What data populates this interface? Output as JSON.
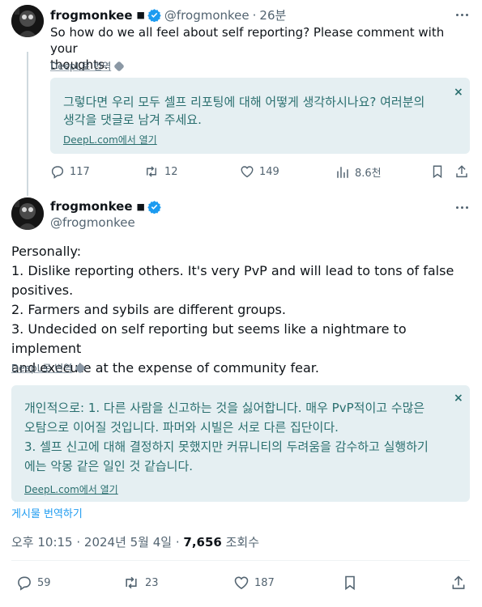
{
  "parent_tweet": {
    "display_name": "frogmonkee",
    "square": "■",
    "handle": "@frogmonkee",
    "separator": "·",
    "time": "26분",
    "text_line1": "So how do we all feel about self reporting? Please comment with your",
    "text_line2": "thoughts.",
    "deepl_label": "DeepL로 번역",
    "translation_line1": "그렇다면 우리 모두 셀프 리포팅에 대해 어떻게 생각하시나요? 여러분의",
    "translation_line2": "생각을 댓글로 남겨 주세요.",
    "translation_link": "DeepL.com에서 열기",
    "close": "×",
    "replies": "117",
    "reposts": "12",
    "likes": "149",
    "views": "8.6천"
  },
  "main_tweet": {
    "display_name": "frogmonkee",
    "square": "■",
    "handle": "@frogmonkee",
    "lines": [
      "Personally:",
      "1. Dislike reporting others. It's very PvP and will lead to tons of false",
      "positives.",
      "2. Farmers and sybils are different groups.",
      "3. Undecided on self reporting but seems like a nightmare to implement",
      "and execute at the expense of community fear."
    ],
    "deepl_label": "DeepL로 번역",
    "translation_lines": [
      "개인적으로: 1. 다른 사람을 신고하는 것을 싫어합니다. 매우 PvP적이고 수많은",
      "오탐으로 이어질 것입니다. 파머와 시빌은 서로 다른 집단이다.",
      "3. 셀프 신고에 대해 결정하지 못했지만 커뮤니티의 두려움을 감수하고 실행하기",
      "에는 악몽 같은 일인 것 같습니다."
    ],
    "translation_link": "DeepL.com에서 열기",
    "close": "×",
    "translate_post": "게시물 번역하기",
    "timestamp": "오후 10:15 · 2024년 5월 4일 · ",
    "view_count": "7,656",
    "views_label": " 조회수",
    "replies": "59",
    "reposts": "23",
    "likes": "187"
  },
  "icons": {
    "verified": "verified-badge-icon",
    "reply": "reply-icon",
    "repost": "repost-icon",
    "like": "heart-icon",
    "views": "analytics-icon",
    "bookmark": "bookmark-icon",
    "share": "share-icon",
    "more": "more-icon"
  },
  "colors": {
    "verified": "#1d9bf0",
    "translation_bg": "#e5eff2",
    "translation_text": "#2a6f6f",
    "secondary_text": "#536471"
  }
}
